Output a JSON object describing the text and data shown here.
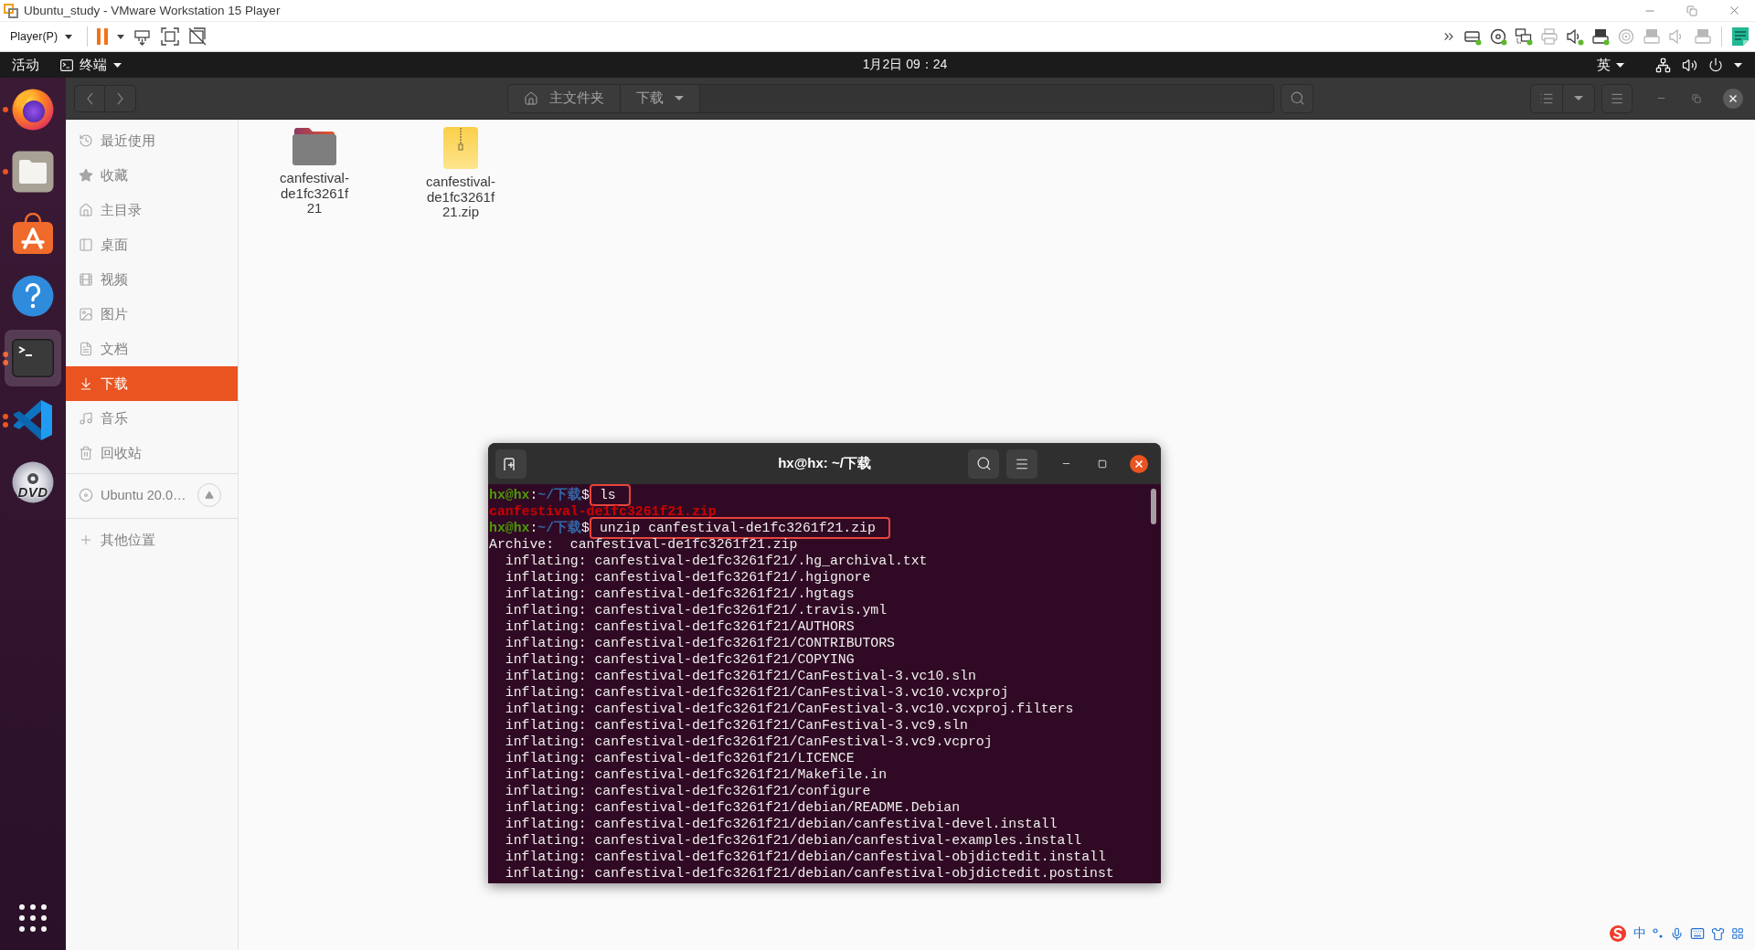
{
  "vm_window": {
    "title": "Ubuntu_study - VMware Workstation 15 Player",
    "player_menu": "Player(P)",
    "devices": [
      {
        "kind": "disk",
        "connected": true
      },
      {
        "kind": "cd",
        "connected": true
      },
      {
        "kind": "network",
        "connected": true
      },
      {
        "kind": "printer",
        "connected": false
      },
      {
        "kind": "sound",
        "connected": true
      },
      {
        "kind": "usb",
        "connected": true
      },
      {
        "kind": "disc",
        "connected": false
      },
      {
        "kind": "usb",
        "connected": false
      },
      {
        "kind": "sound",
        "connected": false
      },
      {
        "kind": "usb",
        "connected": false
      }
    ]
  },
  "top_bar": {
    "activities": "活动",
    "app_menu": "终端",
    "clock": "1月2日 09：24",
    "input_method": "英"
  },
  "dock": {
    "items": [
      {
        "kind": "browser",
        "running": true,
        "multiple_windows": false,
        "selected": false
      },
      {
        "kind": "files",
        "running": true,
        "multiple_windows": false,
        "selected": false
      },
      {
        "kind": "store",
        "running": false,
        "multiple_windows": false,
        "selected": false
      },
      {
        "kind": "help",
        "running": false,
        "multiple_windows": false,
        "selected": false
      },
      {
        "kind": "terminal",
        "running": true,
        "multiple_windows": true,
        "selected": true
      },
      {
        "kind": "editor",
        "running": true,
        "multiple_windows": true,
        "selected": false
      },
      {
        "kind": "disc",
        "running": false,
        "multiple_windows": false,
        "selected": false,
        "label": "DVD"
      }
    ]
  },
  "files": {
    "path": [
      {
        "kind": "home",
        "label": "主文件夹"
      },
      {
        "kind": "current",
        "label": "下载"
      }
    ],
    "sidebar": {
      "places": [
        {
          "kind": "recent",
          "label": "最近使用",
          "selected": false
        },
        {
          "kind": "starred",
          "label": "收藏",
          "selected": false
        },
        {
          "kind": "home",
          "label": "主目录",
          "selected": false
        },
        {
          "kind": "desktop",
          "label": "桌面",
          "selected": false
        },
        {
          "kind": "videos",
          "label": "视频",
          "selected": false
        },
        {
          "kind": "pictures",
          "label": "图片",
          "selected": false
        },
        {
          "kind": "documents",
          "label": "文档",
          "selected": false
        },
        {
          "kind": "downloads",
          "label": "下载",
          "selected": true
        },
        {
          "kind": "music",
          "label": "音乐",
          "selected": false
        },
        {
          "kind": "trash",
          "label": "回收站",
          "selected": false
        }
      ],
      "devices": [
        {
          "label": "Ubuntu 20.0…"
        }
      ],
      "other": [
        {
          "label": "其他位置"
        }
      ]
    },
    "items": [
      {
        "kind": "folder",
        "name": "canfestival-de1fc3261f21"
      },
      {
        "kind": "archive",
        "name": "canfestival-de1fc3261f21.zip"
      }
    ]
  },
  "terminal": {
    "title": "hx@hx: ~/下载",
    "lines": [
      {
        "kind": "prompt",
        "user": "hx@hx",
        "colon": ":",
        "path": "~/下载",
        "symbol": "$",
        "command": "ls",
        "highlighted": true
      },
      {
        "kind": "listing",
        "text": "canfestival-de1fc3261f21.zip"
      },
      {
        "kind": "prompt",
        "user": "hx@hx",
        "colon": ":",
        "path": "~/下载",
        "symbol": "$",
        "command": "unzip canfestival-de1fc3261f21.zip",
        "highlighted": true
      },
      {
        "kind": "output",
        "text": "Archive:  canfestival-de1fc3261f21.zip"
      },
      {
        "kind": "output",
        "text": "  inflating: canfestival-de1fc3261f21/.hg_archival.txt"
      },
      {
        "kind": "output",
        "text": "  inflating: canfestival-de1fc3261f21/.hgignore"
      },
      {
        "kind": "output",
        "text": "  inflating: canfestival-de1fc3261f21/.hgtags"
      },
      {
        "kind": "output",
        "text": "  inflating: canfestival-de1fc3261f21/.travis.yml"
      },
      {
        "kind": "output",
        "text": "  inflating: canfestival-de1fc3261f21/AUTHORS"
      },
      {
        "kind": "output",
        "text": "  inflating: canfestival-de1fc3261f21/CONTRIBUTORS"
      },
      {
        "kind": "output",
        "text": "  inflating: canfestival-de1fc3261f21/COPYING"
      },
      {
        "kind": "output",
        "text": "  inflating: canfestival-de1fc3261f21/CanFestival-3.vc10.sln"
      },
      {
        "kind": "output",
        "text": "  inflating: canfestival-de1fc3261f21/CanFestival-3.vc10.vcxproj"
      },
      {
        "kind": "output",
        "text": "  inflating: canfestival-de1fc3261f21/CanFestival-3.vc10.vcxproj.filters"
      },
      {
        "kind": "output",
        "text": "  inflating: canfestival-de1fc3261f21/CanFestival-3.vc9.sln"
      },
      {
        "kind": "output",
        "text": "  inflating: canfestival-de1fc3261f21/CanFestival-3.vc9.vcproj"
      },
      {
        "kind": "output",
        "text": "  inflating: canfestival-de1fc3261f21/LICENCE"
      },
      {
        "kind": "output",
        "text": "  inflating: canfestival-de1fc3261f21/Makefile.in"
      },
      {
        "kind": "output",
        "text": "  inflating: canfestival-de1fc3261f21/configure"
      },
      {
        "kind": "output",
        "text": "  inflating: canfestival-de1fc3261f21/debian/README.Debian"
      },
      {
        "kind": "output",
        "text": "  inflating: canfestival-de1fc3261f21/debian/canfestival-devel.install"
      },
      {
        "kind": "output",
        "text": "  inflating: canfestival-de1fc3261f21/debian/canfestival-examples.install"
      },
      {
        "kind": "output",
        "text": "  inflating: canfestival-de1fc3261f21/debian/canfestival-objdictedit.install"
      },
      {
        "kind": "output",
        "text": "  inflating: canfestival-de1fc3261f21/debian/canfestival-objdictedit.postinst"
      }
    ]
  },
  "ime": {
    "mode": "中"
  }
}
